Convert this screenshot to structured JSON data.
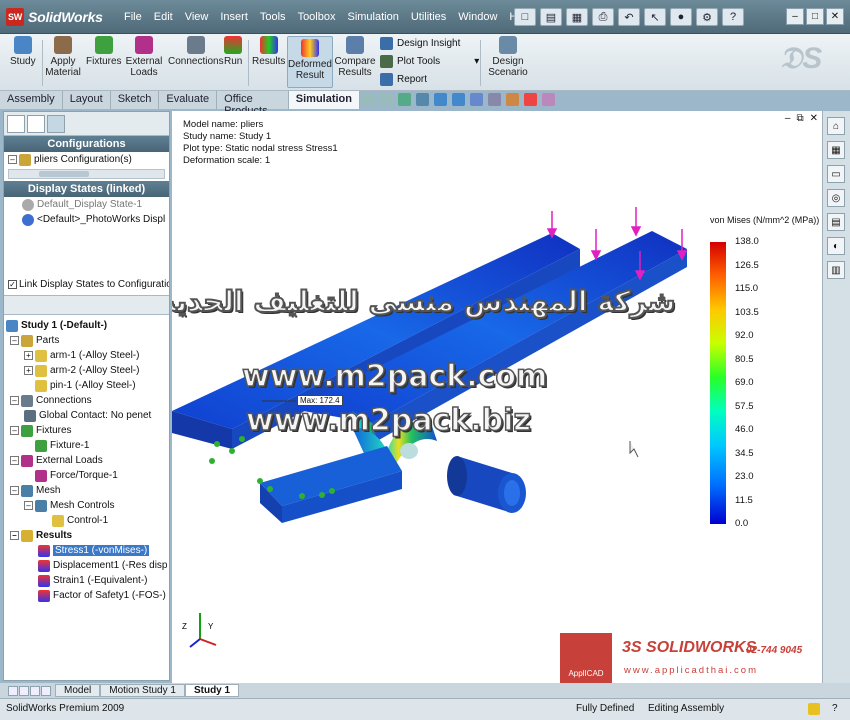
{
  "app": {
    "name": "SolidWorks",
    "logo_text": "SW"
  },
  "menu": [
    "File",
    "Edit",
    "View",
    "Insert",
    "Tools",
    "Toolbox",
    "Simulation",
    "Utilities",
    "Window",
    "Help"
  ],
  "command_manager": {
    "study": "Study",
    "apply_material": "Apply Material",
    "fixtures": "Fixtures",
    "external_loads": "External Loads",
    "connections": "Connections",
    "run": "Run",
    "results": "Results",
    "deformed_result": "Deformed Result",
    "compare_results": "Compare Results",
    "design_insight": "Design Insight",
    "plot_tools": "Plot Tools",
    "report": "Report",
    "design_scenario": "Design Scenario"
  },
  "tabs": [
    "Assembly",
    "Layout",
    "Sketch",
    "Evaluate",
    "Office Products",
    "Simulation"
  ],
  "left_panel": {
    "configurations_header": "Configurations",
    "config_item": "pliers Configuration(s)",
    "display_states_header": "Display States (linked)",
    "display_state_default": "Default_Display State-1",
    "display_state_photoworks": "<Default>_PhotoWorks Displ",
    "link_checkbox_label": "Link Display States to Configuratio",
    "study": "Study 1 (-Default-)",
    "parts": "Parts",
    "arm1": "arm-1 (-Alloy Steel-)",
    "arm2": "arm-2 (-Alloy Steel-)",
    "pin1": "pin-1 (-Alloy Steel-)",
    "connections": "Connections",
    "global_contact": "Global Contact: No penet",
    "fixtures": "Fixtures",
    "fixture1": "Fixture-1",
    "external_loads": "External Loads",
    "force_torque": "Force/Torque-1",
    "mesh": "Mesh",
    "mesh_controls": "Mesh Controls",
    "control1": "Control-1",
    "results": "Results",
    "stress1": "Stress1 (-vonMises-)",
    "displacement1": "Displacement1 (-Res disp",
    "strain1": "Strain1 (-Equivalent-)",
    "fos1": "Factor of Safety1 (-FOS-)"
  },
  "plot_info": {
    "model_name": "Model name: pliers",
    "study_name": "Study name: Study 1",
    "plot_type": "Plot type: Static nodal stress Stress1",
    "deformation_scale": "Deformation scale: 1"
  },
  "legend": {
    "title": "von Mises (N/mm^2 (MPa))",
    "ticks": [
      "138.0",
      "126.5",
      "115.0",
      "103.5",
      "92.0",
      "80.5",
      "69.0",
      "57.5",
      "46.0",
      "34.5",
      "23.0",
      "11.5",
      "0.0"
    ]
  },
  "max_label": "Max: 172.4",
  "watermarks": {
    "arabic": "شركة المهندس منسى للتغليف الحديث",
    "line1": "www.m2pack.com",
    "line2": "www.m2pack.biz"
  },
  "brand": {
    "box_text": "ApplICAD",
    "solidworks": "SOLIDWORKS",
    "phone": "02-744 9045",
    "website": "www.applicadthai.com",
    "ds": "3S"
  },
  "bottom_tabs": [
    "Model",
    "Motion Study 1",
    "Study 1"
  ],
  "status": {
    "product": "SolidWorks Premium 2009",
    "defined": "Fully Defined",
    "mode": "Editing Assembly",
    "help": "?"
  },
  "colors": {
    "accent": "#3a78c8",
    "brand_red": "#c8403a",
    "title_bar": "#55707e"
  }
}
